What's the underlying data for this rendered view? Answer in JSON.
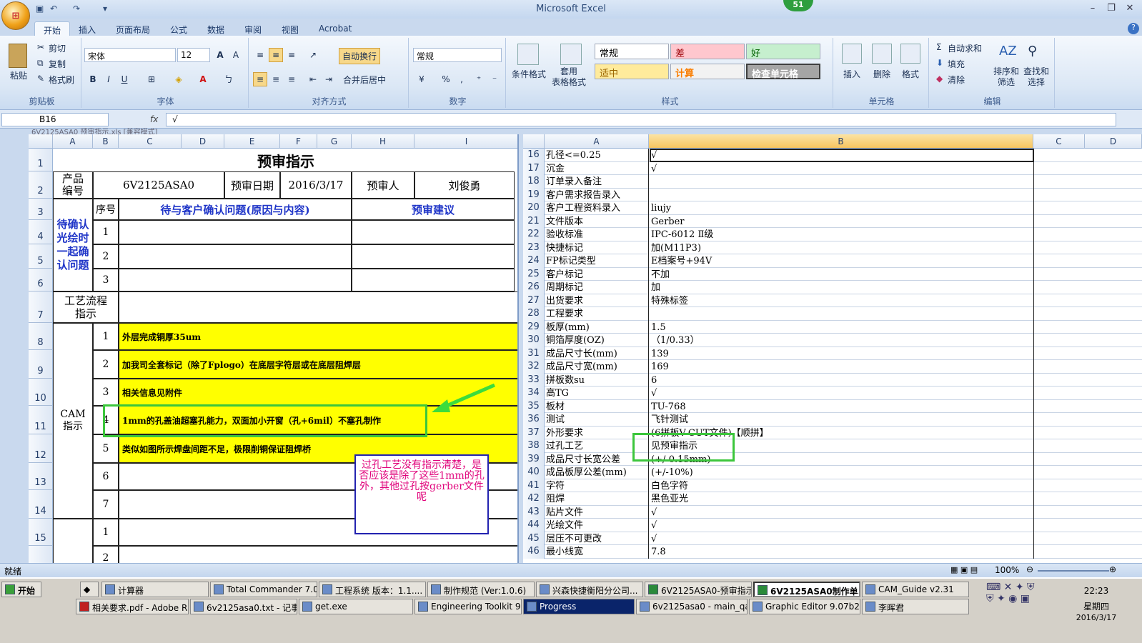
{
  "app": {
    "title": "Microsoft Excel",
    "badge": "51"
  },
  "ribbon_tabs": [
    "开始",
    "插入",
    "页面布局",
    "公式",
    "数据",
    "审阅",
    "视图",
    "Acrobat"
  ],
  "clipboard": {
    "paste": "粘贴",
    "cut": "剪切",
    "copy": "复制",
    "format_painter": "格式刷",
    "label": "剪贴板"
  },
  "font": {
    "name": "宋体",
    "size": "12",
    "label": "字体"
  },
  "alignment": {
    "wrap": "自动换行",
    "merge": "合并后居中",
    "label": "对齐方式"
  },
  "number": {
    "format": "常规",
    "label": "数字"
  },
  "styles": {
    "conditional": "条件格式",
    "table": "套用\n表格格式",
    "cells": [
      "常规",
      "差",
      "好",
      "适中",
      "计算",
      "检查单元格"
    ],
    "label": "样式"
  },
  "cells_group": {
    "insert": "插入",
    "delete": "删除",
    "format": "格式",
    "label": "单元格"
  },
  "editing": {
    "autosum": "自动求和",
    "fill": "填充",
    "clear": "清除",
    "sort": "排序和\n筛选",
    "find": "查找和\n选择",
    "label": "编辑"
  },
  "formula": {
    "namebox": "B16",
    "fx": "fx",
    "value": "√"
  },
  "left_sheet": {
    "doc_title": "6V2125ASA0 预审指示.xls [兼容模式]",
    "cols": [
      "A",
      "B",
      "C",
      "D",
      "E",
      "F",
      "G",
      "H",
      "I"
    ],
    "rows": [
      "1",
      "2",
      "3",
      "4",
      "5",
      "6",
      "7",
      "8",
      "9",
      "10",
      "11",
      "12",
      "13",
      "14",
      "15"
    ],
    "title": "预审指示",
    "product_label": "产品\n编号",
    "product_no": "6V2125ASA0",
    "date_label": "预审日期",
    "date": "2016/3/17",
    "reviewer_label": "预审人",
    "reviewer": "刘俊勇",
    "confirm_label": "待确认\n光绘时\n一起确\n认问题",
    "seq": "序号",
    "issue_header": "待与客户确认问题(原因与内容)",
    "suggest_header": "预审建议",
    "confirm_nums": [
      "1",
      "2",
      "3"
    ],
    "process_label": "工艺流程\n指示",
    "cam_label": "CAM\n指示",
    "cam_nums": [
      "1",
      "2",
      "3",
      "4",
      "5",
      "6",
      "7"
    ],
    "cam_items": [
      "外层完成铜厚35um",
      "加我司全套标记（除了Fplogo）在底层字符层或在底层阻焊层",
      "相关信息见附件",
      "1mm的孔盖油超塞孔能力，双面加小开窗（孔+6mil）不塞孔制作",
      "类似如图所示焊盘间距不足，极限削铜保证阻焊桥",
      "",
      ""
    ],
    "extra_nums": [
      "1",
      "2"
    ],
    "note": "过孔工艺没有指示清楚，是否应该是除了这些1mm的孔外，其他过孔按gerber文件呢"
  },
  "right_sheet": {
    "cols": [
      "A",
      "B",
      "C",
      "D"
    ],
    "rows": [
      [
        "16",
        "孔径<=0.25",
        "√"
      ],
      [
        "17",
        "沉金",
        "√"
      ],
      [
        "18",
        "订单录入备注",
        ""
      ],
      [
        "19",
        "客户需求报告录入",
        ""
      ],
      [
        "20",
        "客户工程资料录入",
        "liujy"
      ],
      [
        "21",
        "文件版本",
        "Gerber"
      ],
      [
        "22",
        "验收标准",
        "IPC-6012 Ⅱ级"
      ],
      [
        "23",
        "快捷标记",
        "加(M11P3)"
      ],
      [
        "24",
        "FP标记类型",
        "E档案号+94V"
      ],
      [
        "25",
        "客户标记",
        "不加"
      ],
      [
        "26",
        "周期标记",
        "加"
      ],
      [
        "27",
        "出货要求",
        "特殊标签"
      ],
      [
        "28",
        "工程要求",
        ""
      ],
      [
        "29",
        "板厚(mm)",
        "1.5"
      ],
      [
        "30",
        "铜箔厚度(OZ)",
        "（1/0.33）"
      ],
      [
        "31",
        "成品尺寸长(mm)",
        "139"
      ],
      [
        "32",
        "成品尺寸宽(mm)",
        "169"
      ],
      [
        "33",
        "拼板数su",
        "6"
      ],
      [
        "34",
        "高TG",
        "√"
      ],
      [
        "35",
        "板材",
        "TU-768"
      ],
      [
        "36",
        "测试",
        "飞针测试"
      ],
      [
        "37",
        "外形要求",
        "(6拼板V-CUT文件)【顺拼】"
      ],
      [
        "38",
        "过孔工艺",
        "见预审指示"
      ],
      [
        "39",
        "成品尺寸长宽公差",
        "(+/-0.15mm)"
      ],
      [
        "40",
        "成品板厚公差(mm)",
        "(+/-10%)"
      ],
      [
        "41",
        "字符",
        "白色字符"
      ],
      [
        "42",
        "阻焊",
        "黑色亚光"
      ],
      [
        "43",
        "贴片文件",
        "√"
      ],
      [
        "44",
        "光绘文件",
        "√"
      ],
      [
        "45",
        "层压不可更改",
        "√"
      ],
      [
        "46",
        "最小线宽",
        "7.8"
      ]
    ]
  },
  "status": {
    "ready": "就绪",
    "zoom": "100%"
  },
  "taskbar": {
    "start": "开始",
    "row1": [
      "计算器",
      "Total Commander 7.0 p...",
      "工程系统  版本：1.1....",
      "制作规范 (Ver:1.0.6)",
      "兴森快捷衡阳分公司...",
      "6V2125ASA0-预审指示...",
      "6V2125ASA0制作单...",
      "CAM_Guide v2.31"
    ],
    "row2": [
      "相关要求.pdf - Adobe R...",
      "6v2125asa0.txt - 记事本",
      "get.exe",
      "Engineering Toolkit 9.07...",
      "Progress",
      "6v2125asa0 - main_qa",
      "Graphic Editor 9.07b2 (0...",
      "李晖君"
    ],
    "time": "22:23",
    "weekday": "星期四",
    "date": "2016/3/17"
  }
}
